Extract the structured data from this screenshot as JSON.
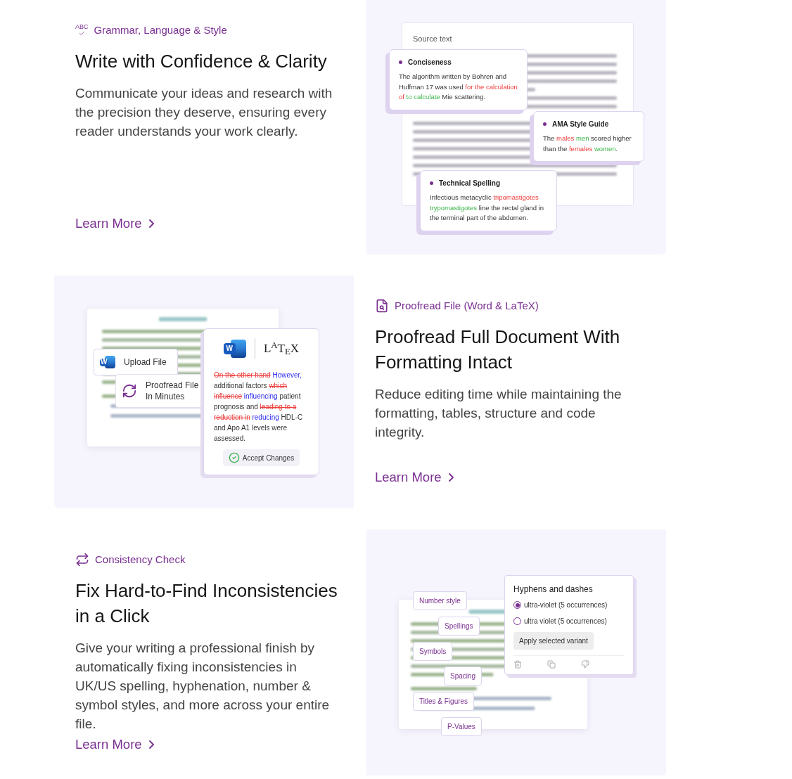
{
  "sections": [
    {
      "kind": "grammar",
      "icon_text": "ABC",
      "eyebrow": "Grammar, Language & Style",
      "title": "Write with Confidence & Clarity",
      "body": "Communicate your ideas and research with the precision they deserve, ensuring every reader understands your work clearly.",
      "link": "Learn More",
      "illustration": {
        "source_label": "Source text",
        "cards": [
          {
            "title": "Conciseness",
            "segments": [
              {
                "kind": "plain",
                "text": "The algorithm written by Bohren and Huffman 17 was used "
              },
              {
                "kind": "wrong",
                "text": "for the calculation of"
              },
              {
                "kind": "fix",
                "text": " to calculate"
              },
              {
                "kind": "plain",
                "text": " Mie scattering."
              }
            ]
          },
          {
            "title": "AMA Style Guide",
            "segments": [
              {
                "kind": "plain",
                "text": "The "
              },
              {
                "kind": "wrong",
                "text": "males"
              },
              {
                "kind": "fix",
                "text": " men"
              },
              {
                "kind": "plain",
                "text": " scored higher than the "
              },
              {
                "kind": "wrong",
                "text": "females"
              },
              {
                "kind": "fix",
                "text": " women"
              },
              {
                "kind": "plain",
                "text": "."
              }
            ]
          },
          {
            "title": "Technical Spelling",
            "segments": [
              {
                "kind": "plain",
                "text": "Infectious metacyclic "
              },
              {
                "kind": "wrong",
                "text": "tripomastigotes"
              },
              {
                "kind": "fix",
                "text": " trypomastigotes"
              },
              {
                "kind": "plain",
                "text": " line the rectal gland in the terminal part of the abdomen."
              }
            ]
          }
        ]
      }
    },
    {
      "kind": "proofread",
      "eyebrow": "Proofread File (Word & LaTeX)",
      "title": "Proofread Full Document With Formatting Intact",
      "body": "Reduce editing time while maintaining the formatting, tables, structure and code integrity.",
      "link": "Learn More",
      "illustration": {
        "upload_word_letter": "W",
        "upload": "Upload File",
        "proofread": "Proofread File In Minutes",
        "edit_word_letter": "W",
        "latex": "L$^{A}$T$_{E}$X",
        "segments": [
          {
            "kind": "deleted",
            "text": "On the other hand"
          },
          {
            "kind": "inserted",
            "text": " However,"
          },
          {
            "kind": "plain",
            "text": " additional factors "
          },
          {
            "kind": "deleted",
            "text": "which influence"
          },
          {
            "kind": "inserted",
            "text": " influencing"
          },
          {
            "kind": "plain",
            "text": " patient prognosis and "
          },
          {
            "kind": "deleted",
            "text": "leading to a reduction in"
          },
          {
            "kind": "inserted",
            "text": " reducing"
          },
          {
            "kind": "plain",
            "text": " HDL-C and Apo A1 levels were assessed."
          }
        ],
        "accept": "Accept Changes"
      }
    },
    {
      "kind": "consistency",
      "eyebrow": "Consistency Check",
      "title": "Fix Hard-to-Find Inconsistencies in a Click",
      "body": "Give your writing a professional finish by automatically fixing inconsistencies in UK/US spelling, hyphenation, number & symbol styles, and more across your entire file.",
      "link": "Learn More",
      "illustration": {
        "tags": [
          "Number style",
          "Spellings",
          "Symbols",
          "Spacing",
          "Titles & Figures",
          "P-Values"
        ],
        "popup_title": "Hyphens and dashes",
        "options": [
          {
            "label": "ultra-violet (5 occurrences)",
            "selected": true
          },
          {
            "label": "ultra violet (5 occurrences)",
            "selected": false
          }
        ],
        "apply": "Apply selected variant"
      }
    }
  ]
}
